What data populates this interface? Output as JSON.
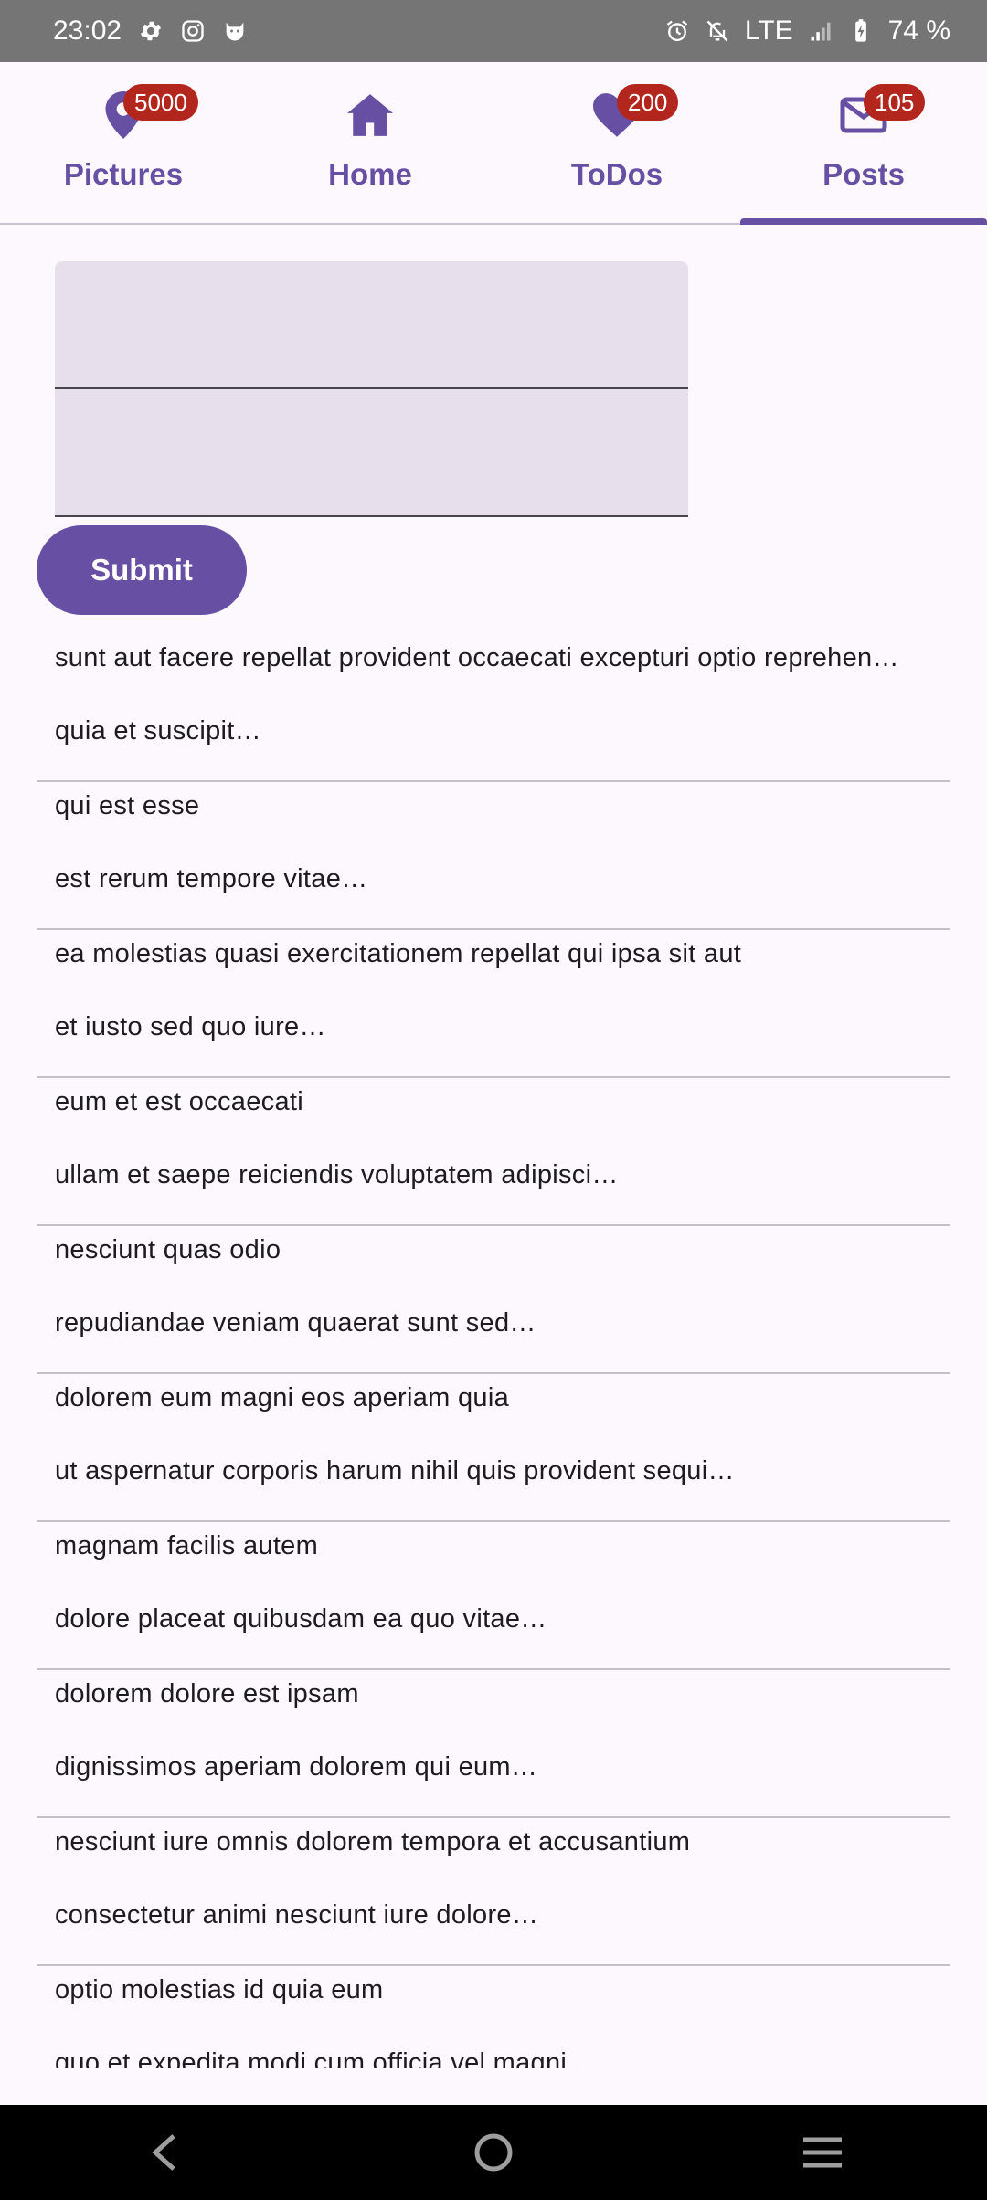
{
  "status_bar": {
    "time": "23:02",
    "network": "LTE",
    "battery": "74 %",
    "left_icons": [
      "settings-icon",
      "instagram-icon",
      "cat-icon"
    ],
    "right_icons": [
      "alarm-icon",
      "notifications-off-icon",
      "signal-icon",
      "battery-charging-icon"
    ]
  },
  "tabs": [
    {
      "label": "Pictures",
      "icon": "location-pin-icon",
      "badge": "5000",
      "active": false
    },
    {
      "label": "Home",
      "icon": "home-icon",
      "badge": "",
      "active": false
    },
    {
      "label": "ToDos",
      "icon": "heart-icon",
      "badge": "200",
      "active": false
    },
    {
      "label": "Posts",
      "icon": "mail-icon",
      "badge": "105",
      "active": true
    }
  ],
  "form": {
    "title_value": "",
    "body_value": "",
    "submit_label": "Submit"
  },
  "posts": [
    {
      "title": "sunt aut facere repellat provident occaecati excepturi optio reprehen…",
      "body": "quia et suscipit…"
    },
    {
      "title": "qui est esse",
      "body": "est rerum tempore vitae…"
    },
    {
      "title": "ea molestias quasi exercitationem repellat qui ipsa sit aut",
      "body": "et iusto sed quo iure…"
    },
    {
      "title": "eum et est occaecati",
      "body": "ullam et saepe reiciendis voluptatem adipisci…"
    },
    {
      "title": "nesciunt quas odio",
      "body": "repudiandae veniam quaerat sunt sed…"
    },
    {
      "title": "dolorem eum magni eos aperiam quia",
      "body": "ut aspernatur corporis harum nihil quis provident sequi…"
    },
    {
      "title": "magnam facilis autem",
      "body": "dolore placeat quibusdam ea quo vitae…"
    },
    {
      "title": "dolorem dolore est ipsam",
      "body": "dignissimos aperiam dolorem qui eum…"
    },
    {
      "title": "nesciunt iure omnis dolorem tempora et accusantium",
      "body": "consectetur animi nesciunt iure dolore…"
    },
    {
      "title": "optio molestias id quia eum",
      "body": "quo et expedita modi cum officia vel magni…"
    }
  ],
  "navbar": [
    "back-icon",
    "home-circle-icon",
    "recents-icon"
  ],
  "colors": {
    "accent": "#6750a4",
    "badge": "#b3261e",
    "field": "#e7e0ec"
  }
}
